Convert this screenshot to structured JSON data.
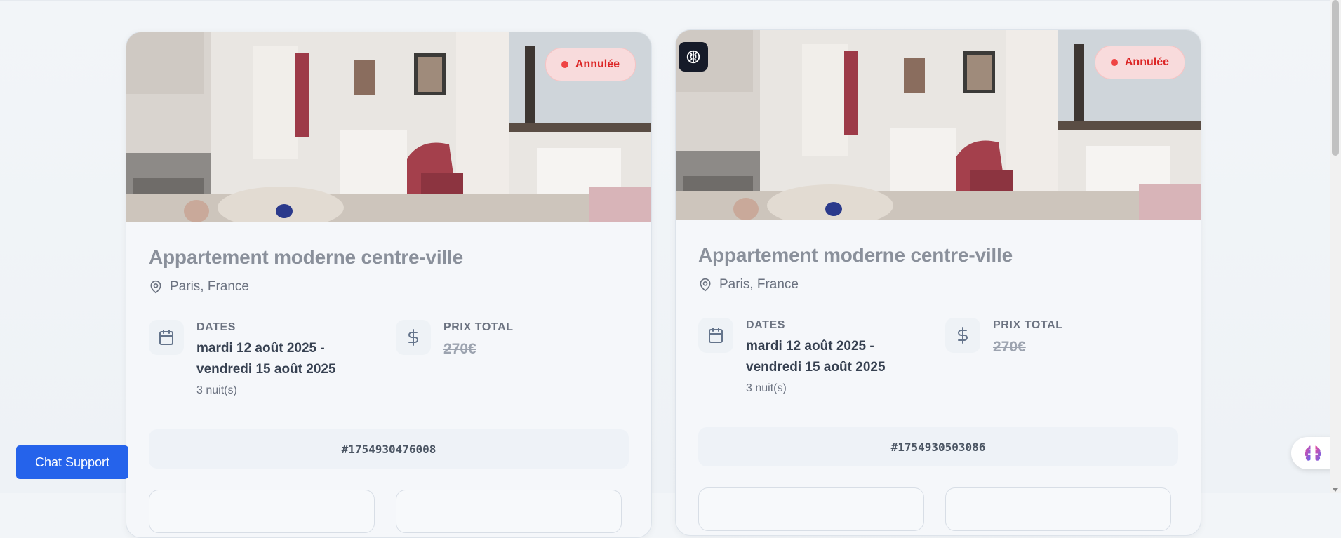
{
  "colors": {
    "primary_button": "#2563eb",
    "status_cancelled": "#dc2626",
    "card_bg": "#f5f7fa"
  },
  "bookings": [
    {
      "status": "Annulée",
      "title": "Appartement moderne centre-ville",
      "location": "Paris, France",
      "dates_label": "DATES",
      "dates_value": "mardi 12 août 2025 - vendredi 15 août 2025",
      "nights": "3 nuit(s)",
      "price_label": "PRIX TOTAL",
      "price_value": "270€",
      "booking_id": "#1754930476008",
      "icons": [
        "calendar-icon",
        "dollar-icon",
        "location-pin-icon"
      ]
    },
    {
      "status": "Annulée",
      "title": "Appartement moderne centre-ville",
      "location": "Paris, France",
      "dates_label": "DATES",
      "dates_value": "mardi 12 août 2025 - vendredi 15 août 2025",
      "nights": "3 nuit(s)",
      "price_label": "PRIX TOTAL",
      "price_value": "270€",
      "booking_id": "#1754930503086",
      "icons": [
        "brain-icon",
        "calendar-icon",
        "dollar-icon",
        "location-pin-icon"
      ]
    }
  ],
  "chat_support": {
    "label": "Chat Support"
  },
  "assistant_fab": {
    "icon": "brain-icon"
  }
}
